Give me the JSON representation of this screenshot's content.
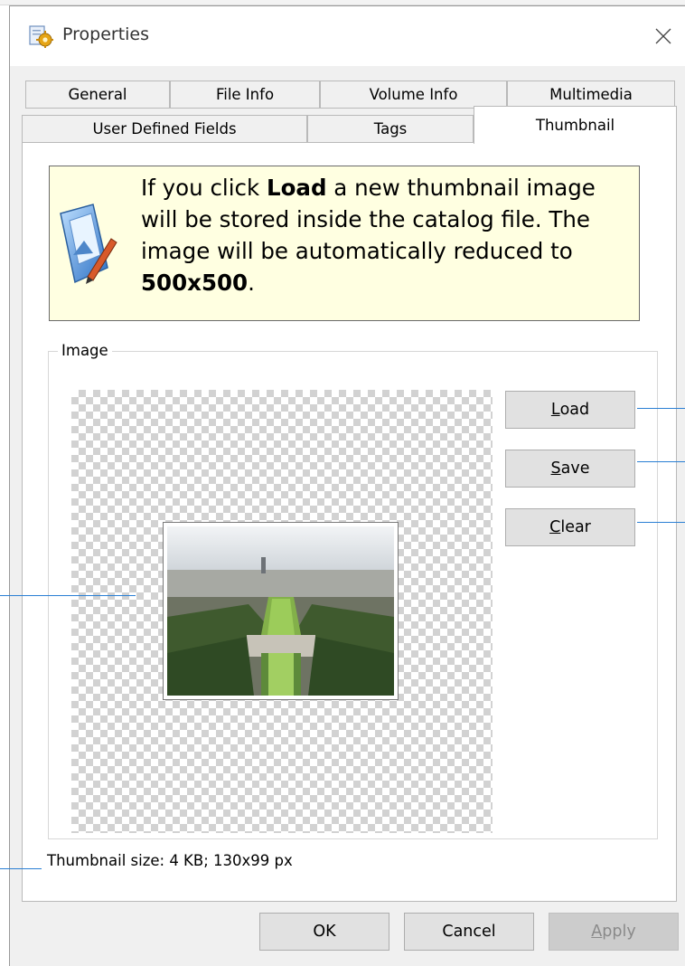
{
  "window": {
    "title": "Properties",
    "close_label": "×"
  },
  "tabs": {
    "row1": [
      "General",
      "File Info",
      "Volume Info",
      "Multimedia"
    ],
    "row2": [
      "User Defined Fields",
      "Tags",
      "Thumbnail"
    ],
    "active": "Thumbnail"
  },
  "info": {
    "text_before_load": "If you click ",
    "load_bold": "Load",
    "text_after_load": " a new thumbnail image will be stored inside the catalog file. The image will be automatically reduced to ",
    "size_bold": "500x500",
    "text_end": "."
  },
  "image_group": {
    "label": "Image"
  },
  "buttons": {
    "load_accel": "L",
    "load_rest": "oad",
    "save_accel": "S",
    "save_rest": "ave",
    "clear_accel": "C",
    "clear_rest": "lear"
  },
  "status": {
    "thumbnail_size": "Thumbnail size: 4 KB; 130x99 px"
  },
  "footer": {
    "ok_label": "OK",
    "cancel_label": "Cancel",
    "apply_accel": "A",
    "apply_rest": "pply"
  },
  "colors": {
    "info_background": "#ffffe1",
    "callout_line": "#2a7fd4"
  }
}
